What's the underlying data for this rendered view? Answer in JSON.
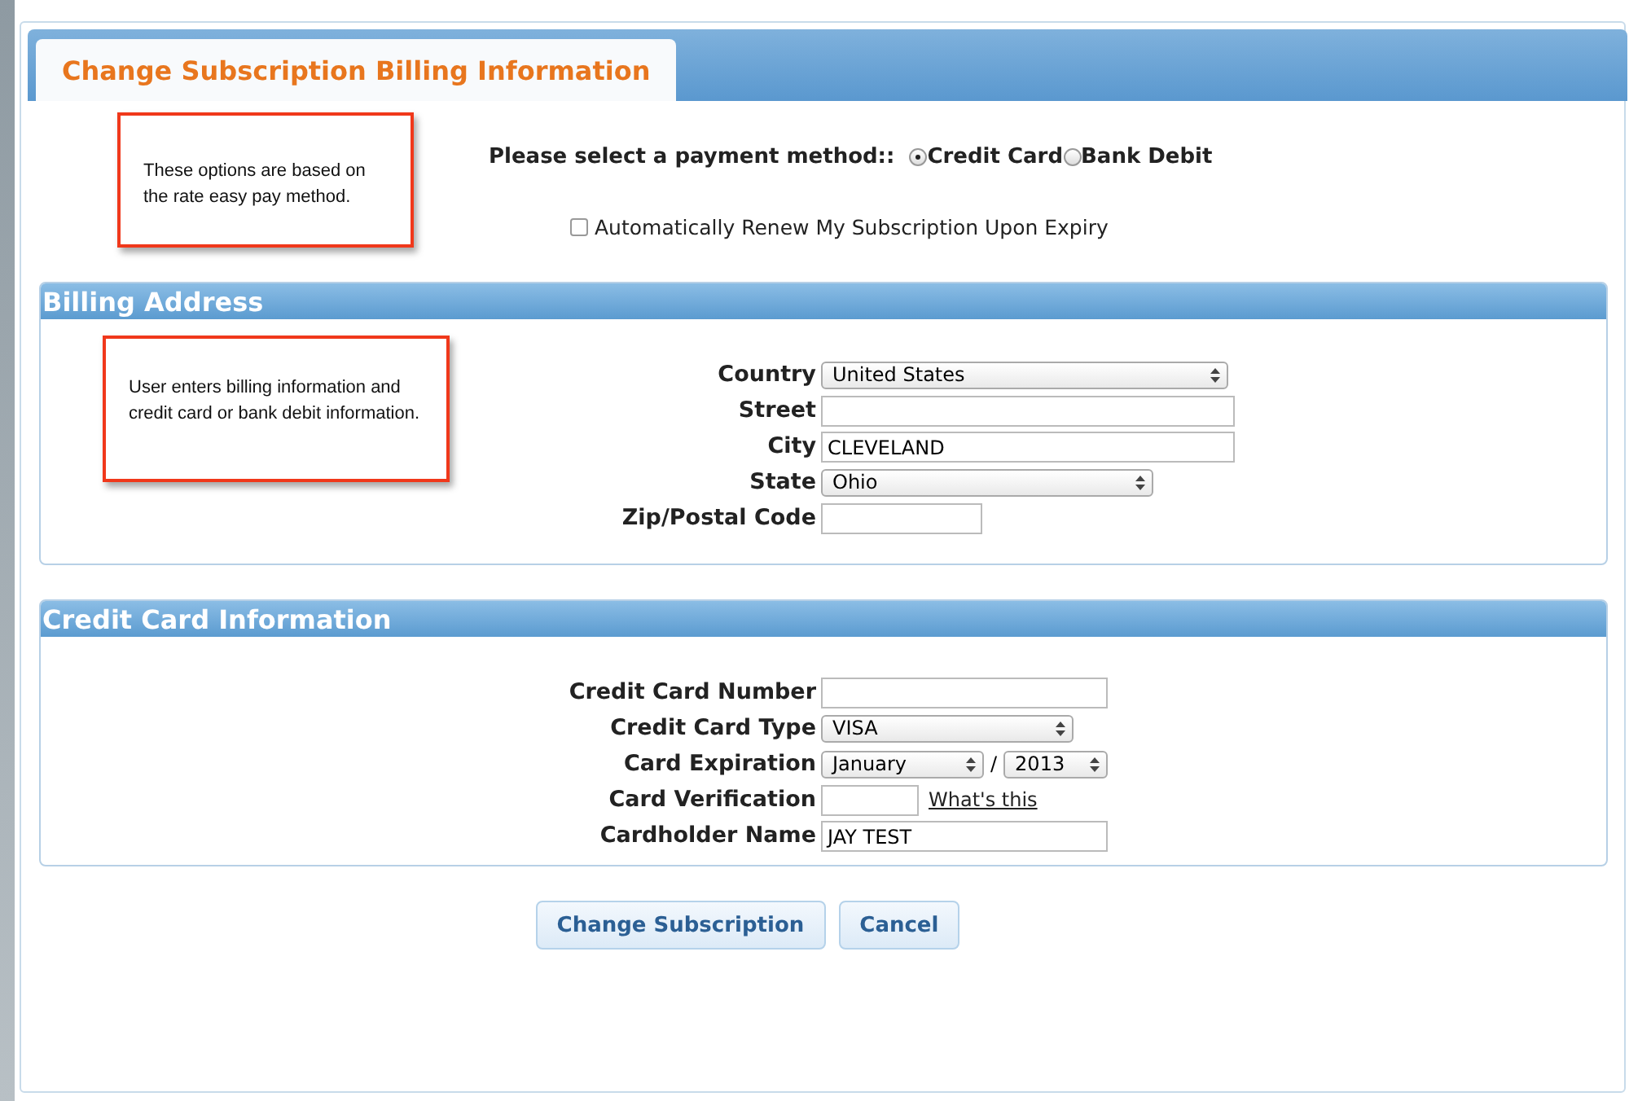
{
  "tab": {
    "title": "Change Subscription Billing Information"
  },
  "notes": [
    "These options are based on the rate easy pay method.",
    "User enters billing information and credit card or bank debit information."
  ],
  "payment": {
    "label": "Please select a payment method::",
    "options": [
      {
        "label": "Credit Card",
        "selected": true
      },
      {
        "label": "Bank Debit",
        "selected": false
      }
    ]
  },
  "auto_renew": {
    "label": "Automatically Renew My Subscription Upon Expiry",
    "checked": false
  },
  "sections": [
    {
      "title": "Billing Address",
      "fields": [
        {
          "kind": "select",
          "label": "Country",
          "value": "United States"
        },
        {
          "kind": "text",
          "label": "Street"
        },
        {
          "kind": "text",
          "label": "City",
          "value": "CLEVELAND"
        },
        {
          "kind": "select",
          "label": "State",
          "value": "Ohio"
        },
        {
          "kind": "text",
          "label": "Zip/Postal Code"
        }
      ]
    },
    {
      "title": "Credit Card Information",
      "fields": [
        {
          "kind": "text",
          "label": "Credit Card Number"
        },
        {
          "kind": "select",
          "label": "Credit Card Type",
          "value": "VISA"
        },
        {
          "kind": "expiry",
          "label": "Card Expiration",
          "month": "January",
          "separator": "/",
          "year": "2013"
        },
        {
          "kind": "text_link",
          "label": "Card Verification",
          "link": "What's this"
        },
        {
          "kind": "text",
          "label": "Cardholder Name",
          "value": "JAY TEST"
        }
      ]
    }
  ],
  "buttons": [
    "Change Subscription",
    "Cancel"
  ]
}
